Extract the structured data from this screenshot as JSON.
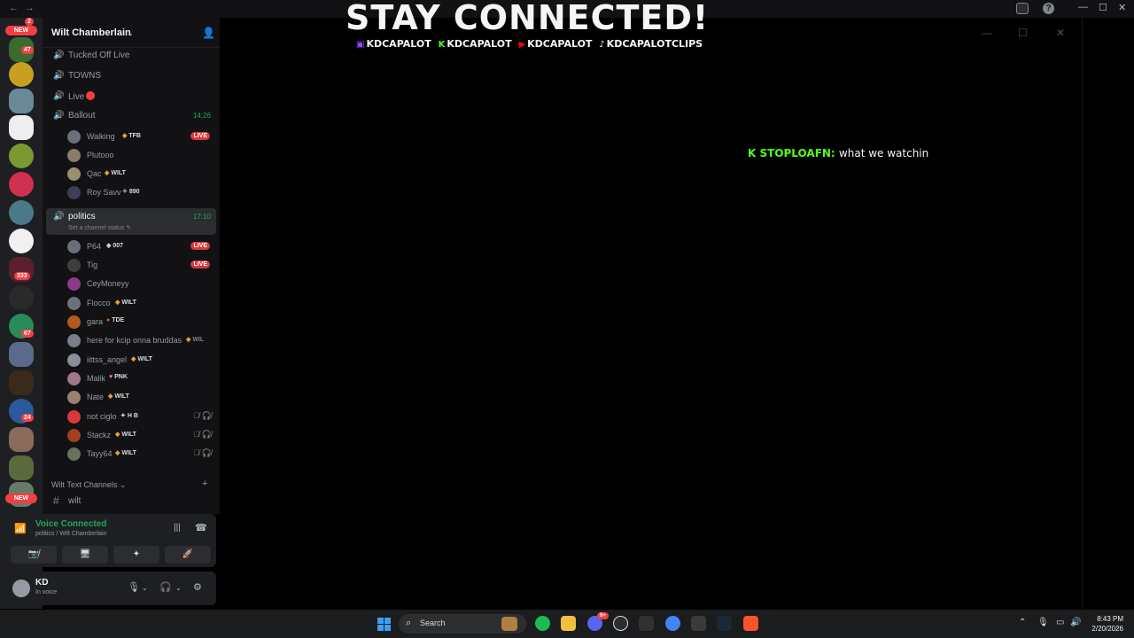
{
  "window": {
    "nav_back": "←",
    "nav_forward": "→",
    "minimize": "—",
    "maximize": "☐",
    "close": "✕",
    "help": "?"
  },
  "rail": {
    "badges": {
      "top": "2",
      "new_top": "NEW",
      "b47": "47",
      "b333": "333",
      "b67": "67",
      "b24": "24",
      "new_bottom": "NEW"
    }
  },
  "guild": {
    "name": "Wilt Chamberlain",
    "chevron": "⌄",
    "invite_icon": "👤"
  },
  "channels": [
    {
      "name": "Tucked Off Live",
      "icon": "🔊"
    },
    {
      "name": "TOWNS",
      "icon": "🔊"
    },
    {
      "name": "Live",
      "icon": "🔊"
    },
    {
      "name": "Ballout",
      "icon": "🔊",
      "time": "14:26"
    },
    {
      "name": "politics",
      "icon": "🔊",
      "time": "17:10",
      "status": "Set a channel status ✎"
    }
  ],
  "ballout_users": [
    {
      "name": "Walking",
      "tag": "TFB",
      "tag_icon": "◈",
      "live": "LIVE",
      "color": "#6b6f7a"
    },
    {
      "name": "Plutooo",
      "tag": "",
      "tag_icon": "",
      "color": "#8a7b6a"
    },
    {
      "name": "Qac",
      "tag": "WILT",
      "tag_icon": "◈",
      "color": "#9a9070"
    },
    {
      "name": "Roy Savv",
      "tag": "890",
      "tag_icon": "✧",
      "color": "#3d3f58"
    }
  ],
  "politics_users": [
    {
      "name": "P64",
      "tag": "007",
      "tag_icon": "◈",
      "live": "LIVE",
      "color": "#6a6e78"
    },
    {
      "name": "Tig",
      "tag": "",
      "tag_icon": "",
      "live": "LIVE",
      "color": "#3e3e3e"
    },
    {
      "name": "CeyMoneyy",
      "tag": "",
      "tag_icon": "",
      "color": "#8a3a8a"
    },
    {
      "name": "Flocco",
      "tag": "WILT",
      "tag_icon": "◈",
      "color": "#6e7278"
    },
    {
      "name": "gara",
      "tag": "TDE",
      "tag_icon": "●",
      "color": "#b05a20"
    },
    {
      "name": "here for kcip onna bruddas",
      "tag": "WIL",
      "tag_icon": "◈",
      "color": "#7a7e88"
    },
    {
      "name": "iittss_angel",
      "tag": "WILT",
      "tag_icon": "◈",
      "color": "#8a8e98"
    },
    {
      "name": "Malik",
      "tag": "PNK",
      "tag_icon": "♥",
      "color": "#a07888"
    },
    {
      "name": "Nate",
      "tag": "WILT",
      "tag_icon": "◈",
      "color": "#9a8070"
    },
    {
      "name": "not ciglo",
      "tag": "H B",
      "tag_icon": "✦",
      "muted": "🎙̸ 🎧̸",
      "color": "#da373c"
    },
    {
      "name": "Stackz",
      "tag": "WILT",
      "tag_icon": "◈",
      "muted": "🎙̸ 🎧̸",
      "color": "#a04020"
    },
    {
      "name": "Tayy64",
      "tag": "WILT",
      "tag_icon": "◈",
      "muted": "🎙̸ 🎧̸",
      "color": "#6a7060"
    }
  ],
  "text_category": {
    "label": "Wilt Text Channels ⌄",
    "plus": "+",
    "channel": "wilt",
    "channel_icon": "#"
  },
  "voice": {
    "title": "Voice Connected",
    "sub": "politics / Wilt Chamberlain",
    "buttons": [
      "📷̸",
      "🖥",
      "✦",
      "🚀"
    ]
  },
  "user": {
    "name": "KD",
    "status": "In voice"
  },
  "stream": {
    "banner": "STAY CONNECTED!",
    "socials": [
      {
        "icon": "▣",
        "handle": "KDCAPALOT"
      },
      {
        "icon": "K",
        "handle": "KDCAPALOT"
      },
      {
        "icon": "▶",
        "handle": "KDCAPALOT"
      },
      {
        "icon": "♪",
        "handle": "KDCAPALOTCLIPS"
      }
    ],
    "chat_user": "STOPLOAFN:",
    "chat_message": "what we watchin"
  },
  "taskbar": {
    "search": "Search",
    "time": "8:43 PM",
    "date": "2/20/2026",
    "discord_badge": "9+"
  },
  "colors": {
    "accent_green": "#23a55a",
    "live_red": "#da373c",
    "kick_green": "#53fc18"
  }
}
